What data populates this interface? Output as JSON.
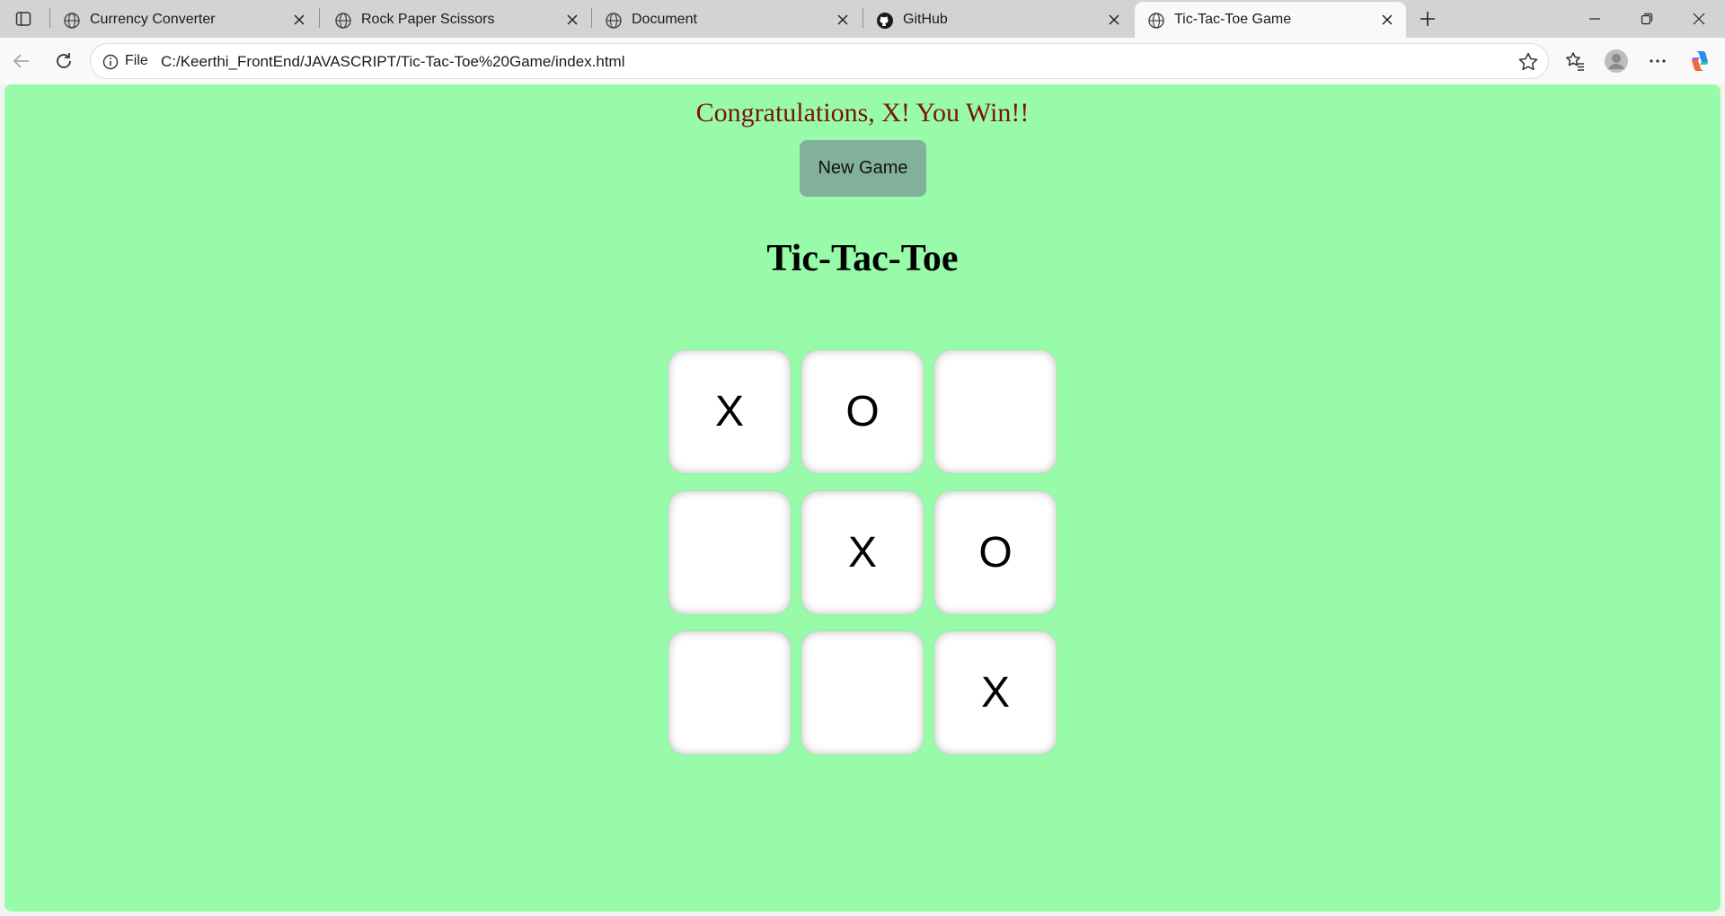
{
  "browser": {
    "tabs": [
      {
        "label": "Currency Converter",
        "icon": "globe-icon",
        "active": false
      },
      {
        "label": "Rock Paper Scissors",
        "icon": "globe-icon",
        "active": false
      },
      {
        "label": "Document",
        "icon": "globe-icon",
        "active": false
      },
      {
        "label": "GitHub",
        "icon": "github-icon",
        "active": false
      },
      {
        "label": "Tic-Tac-Toe Game",
        "icon": "globe-icon",
        "active": true
      }
    ],
    "address": {
      "scheme_label": "File",
      "url": "C:/Keerthi_FrontEnd/JAVASCRIPT/Tic-Tac-Toe%20Game/index.html"
    }
  },
  "game": {
    "message": "Congratulations, X! You Win!!",
    "new_game_label": "New Game",
    "title": "Tic-Tac-Toe",
    "board": [
      [
        "X",
        "O",
        ""
      ],
      [
        "",
        "X",
        "O"
      ],
      [
        "",
        "",
        "X"
      ]
    ]
  },
  "colors": {
    "page_background": "#98fbaa",
    "message_color": "#7b1212",
    "button_background": "#82b09c"
  }
}
